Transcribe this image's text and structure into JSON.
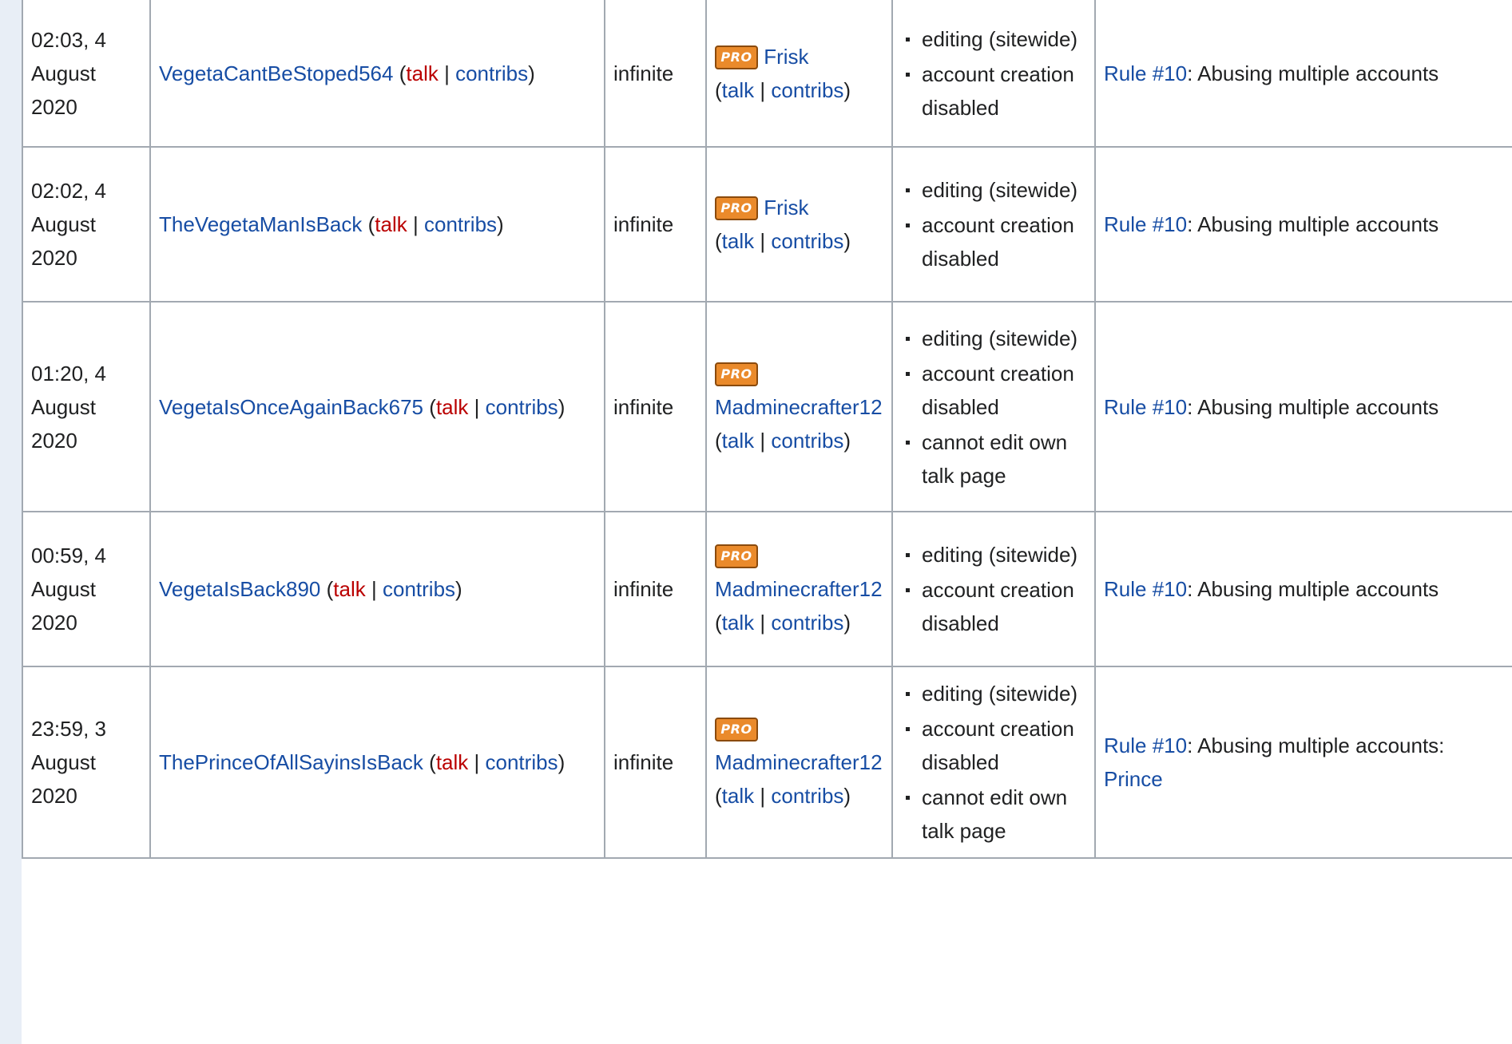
{
  "separator": "|",
  "open_paren": "(",
  "close_paren": ")",
  "colon": ":",
  "colors": {
    "link": "#174da4",
    "redlink": "#ba0000",
    "pro_badge": "#ea8a2b",
    "border": "#a2a9b1",
    "side_strip": "#e8eef6"
  },
  "rows": [
    {
      "time": [
        "02:03, 4",
        "August",
        "2020"
      ],
      "user": "VegetaCantBeStoped564",
      "user_talk": "talk",
      "user_contribs": "contribs",
      "expiry": "infinite",
      "admin_badge": "PRO",
      "admin": "Frisk",
      "admin_inline": true,
      "admin_talk": "talk",
      "admin_contribs": "contribs",
      "params": [
        "editing (sitewide)",
        "account creation disabled"
      ],
      "rule_link": "Rule #10",
      "reason": "Abusing multiple accounts",
      "reason_link": ""
    },
    {
      "time": [
        "02:02, 4",
        "August",
        "2020"
      ],
      "user": "TheVegetaManIsBack",
      "user_talk": "talk",
      "user_contribs": "contribs",
      "expiry": "infinite",
      "admin_badge": "PRO",
      "admin": "Frisk",
      "admin_inline": true,
      "admin_talk": "talk",
      "admin_contribs": "contribs",
      "params": [
        "editing (sitewide)",
        "account creation disabled"
      ],
      "rule_link": "Rule #10",
      "reason": "Abusing multiple accounts",
      "reason_link": ""
    },
    {
      "time": [
        "01:20, 4",
        "August",
        "2020"
      ],
      "user": "VegetaIsOnceAgainBack675",
      "user_talk": "talk",
      "user_contribs": "contribs",
      "expiry": "infinite",
      "admin_badge": "PRO",
      "admin": "Madminecrafter12",
      "admin_inline": false,
      "admin_talk": "talk",
      "admin_contribs": "contribs",
      "params": [
        "editing (sitewide)",
        "account creation disabled",
        "cannot edit own talk page"
      ],
      "rule_link": "Rule #10",
      "reason": "Abusing multiple accounts",
      "reason_link": ""
    },
    {
      "time": [
        "00:59, 4",
        "August",
        "2020"
      ],
      "user": "VegetaIsBack890",
      "user_talk": "talk",
      "user_contribs": "contribs",
      "expiry": "infinite",
      "admin_badge": "PRO",
      "admin": "Madminecrafter12",
      "admin_inline": false,
      "admin_talk": "talk",
      "admin_contribs": "contribs",
      "params": [
        "editing (sitewide)",
        "account creation disabled"
      ],
      "rule_link": "Rule #10",
      "reason": "Abusing multiple accounts",
      "reason_link": ""
    },
    {
      "time": [
        "23:59, 3",
        "August",
        "2020"
      ],
      "user": "ThePrinceOfAllSayinsIsBack",
      "user_talk": "talk",
      "user_contribs": "contribs",
      "expiry": "infinite",
      "admin_badge": "PRO",
      "admin": "Madminecrafter12",
      "admin_inline": false,
      "admin_talk": "talk",
      "admin_contribs": "contribs",
      "params": [
        "editing (sitewide)",
        "account creation disabled",
        "cannot edit own talk page"
      ],
      "rule_link": "Rule #10",
      "reason": "Abusing multiple accounts",
      "reason_link": "Prince"
    }
  ]
}
